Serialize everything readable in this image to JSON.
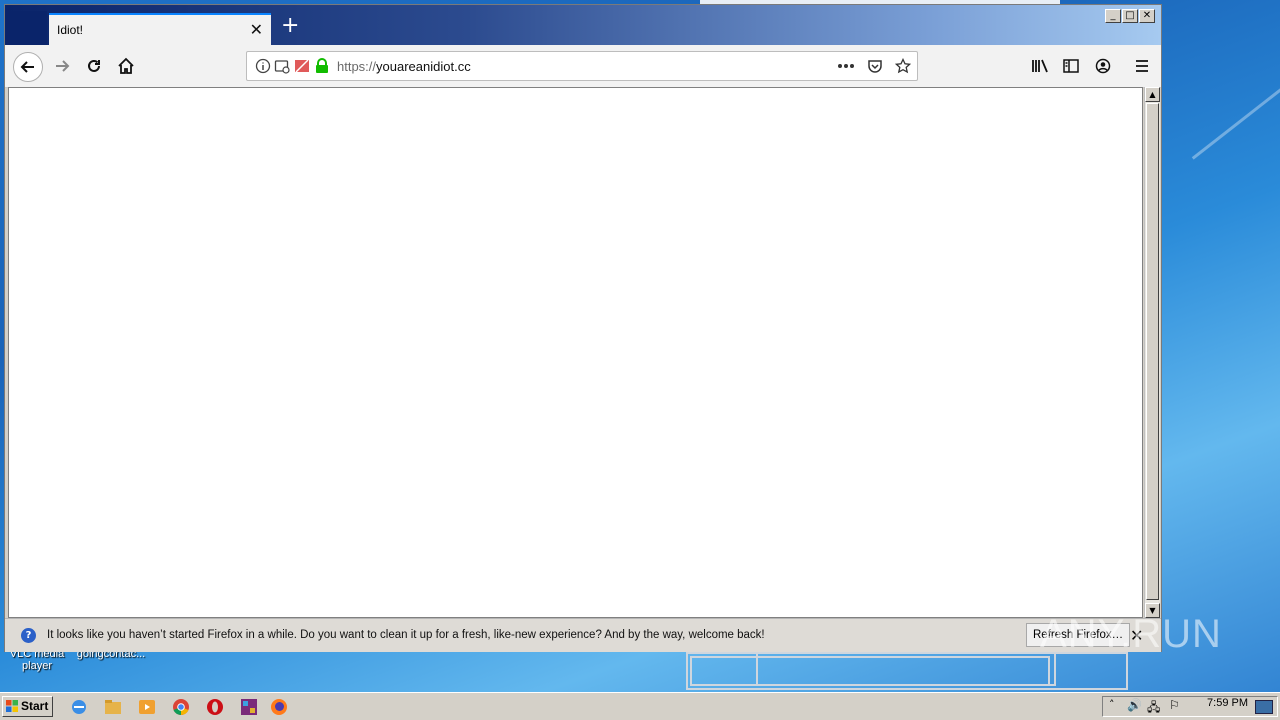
{
  "browser": {
    "tab": {
      "title": "Idiot!"
    },
    "url": {
      "scheme": "https://",
      "host": "youareanidiot.cc"
    }
  },
  "notification": {
    "message": "It looks like you haven’t started Firefox in a while. Do you want to clean it up for a fresh, like-new experience? And by the way, welcome back!",
    "button_label": "Refresh Firefox…"
  },
  "desktop": {
    "icon_labels": [
      "VLC media player",
      "goingcontac..."
    ],
    "watermark": "ANY.RUN"
  },
  "taskbar": {
    "start_label": "Start",
    "clock": "7:59 PM"
  },
  "icons": [
    "back-icon",
    "forward-icon",
    "reload-icon",
    "home-icon",
    "info-icon",
    "permissions-icon",
    "autoplay-icon",
    "lock-icon",
    "more-icon",
    "pocket-icon",
    "bookmark-star-icon",
    "library-icon",
    "sidebar-icon",
    "account-icon",
    "menu-icon"
  ],
  "colors": {
    "accent": "#0a84ff",
    "lock_green": "#12bc00",
    "titlebar": "#0a246a"
  }
}
